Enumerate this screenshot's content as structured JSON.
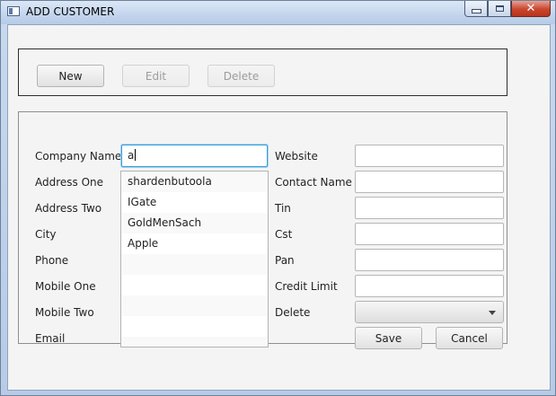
{
  "window": {
    "title": "ADD CUSTOMER",
    "close_glyph": "✕"
  },
  "toolbar": {
    "new": "New",
    "edit": "Edit",
    "delete": "Delete"
  },
  "form": {
    "company_name_label": "Company Name",
    "company_name_value": "a",
    "address_one_label": "Address One",
    "address_two_label": "Address Two",
    "city_label": "City",
    "phone_label": "Phone",
    "mobile_one_label": "Mobile One",
    "mobile_two_label": "Mobile Two",
    "email_label": "Email",
    "website_label": "Website",
    "contact_name_label": "Contact Name",
    "tin_label": "Tin",
    "cst_label": "Cst",
    "pan_label": "Pan",
    "credit_limit_label": "Credit Limit",
    "delete_label": "Delete",
    "save": "Save",
    "cancel": "Cancel"
  },
  "suggestions": [
    "shardenbutoola",
    "IGate",
    "GoldMenSach",
    "Apple",
    "",
    "",
    "",
    "",
    ""
  ]
}
